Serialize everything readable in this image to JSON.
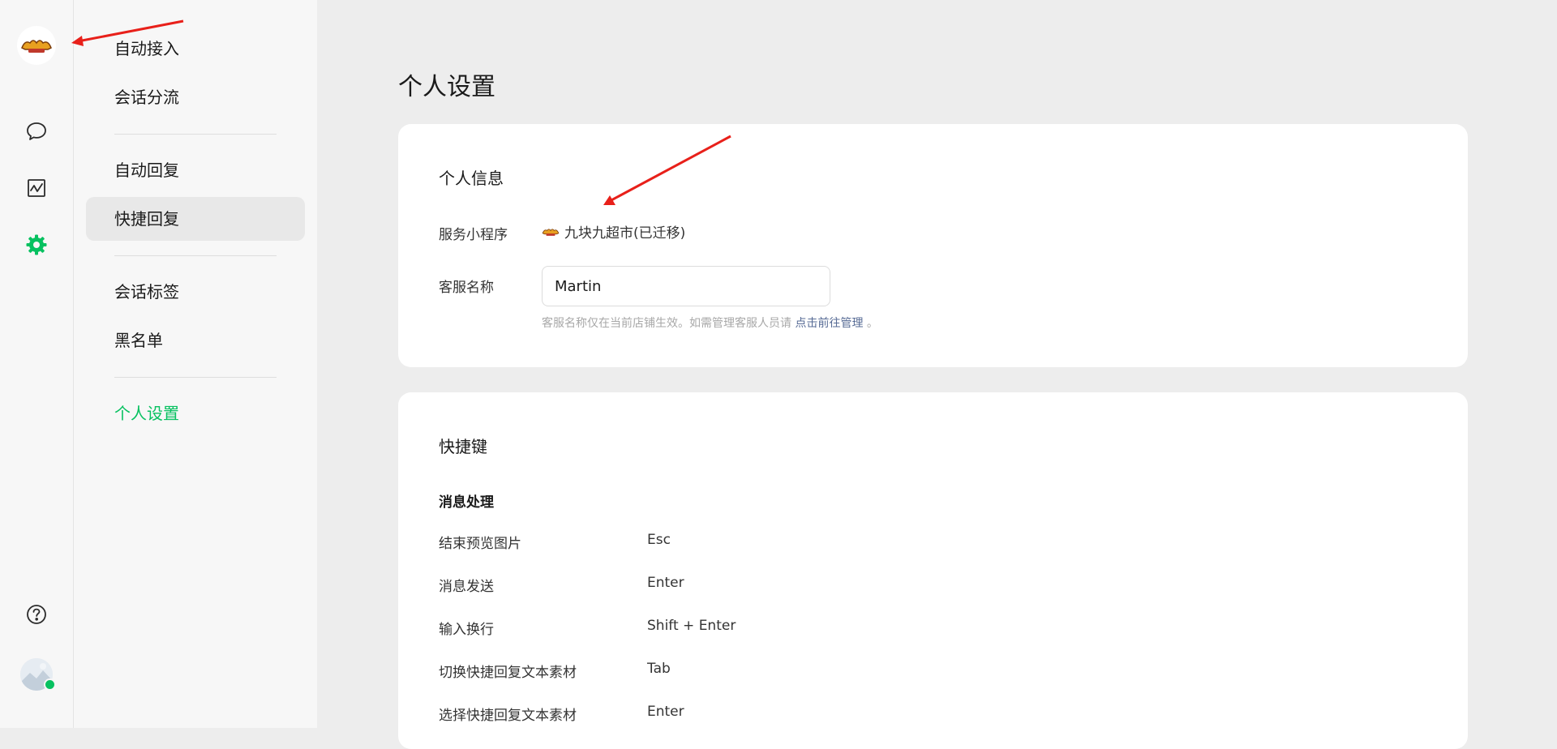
{
  "rail": {
    "icons": [
      "store-logo-icon",
      "chat-bubble-icon",
      "chart-icon",
      "settings-gear-icon",
      "help-icon",
      "agent-avatar"
    ],
    "accent_color": "#07c160"
  },
  "menu": {
    "items": [
      {
        "label": "自动接入"
      },
      {
        "label": "会话分流"
      },
      {
        "label": "自动回复"
      },
      {
        "label": "快捷回复"
      },
      {
        "label": "会话标签"
      },
      {
        "label": "黑名单"
      },
      {
        "label": "个人设置"
      }
    ],
    "hovered_index": 3,
    "current_index": 6
  },
  "page": {
    "title": "个人设置"
  },
  "profile": {
    "section_title": "个人信息",
    "service_label": "服务小程序",
    "service_value": "九块九超市(已迁移)",
    "name_label": "客服名称",
    "name_value": "Martin",
    "hint_text": "客服名称仅在当前店铺生效。如需管理客服人员请",
    "hint_link": "点击前往管理",
    "hint_suffix": "。"
  },
  "shortcuts": {
    "section_title": "快捷键",
    "group_title": "消息处理",
    "rows": [
      {
        "action": "结束预览图片",
        "key": "Esc"
      },
      {
        "action": "消息发送",
        "key": "Enter"
      },
      {
        "action": "输入换行",
        "key": "Shift + Enter"
      },
      {
        "action": "切换快捷回复文本素材",
        "key": "Tab"
      },
      {
        "action": "选择快捷回复文本素材",
        "key": "Enter"
      }
    ]
  }
}
